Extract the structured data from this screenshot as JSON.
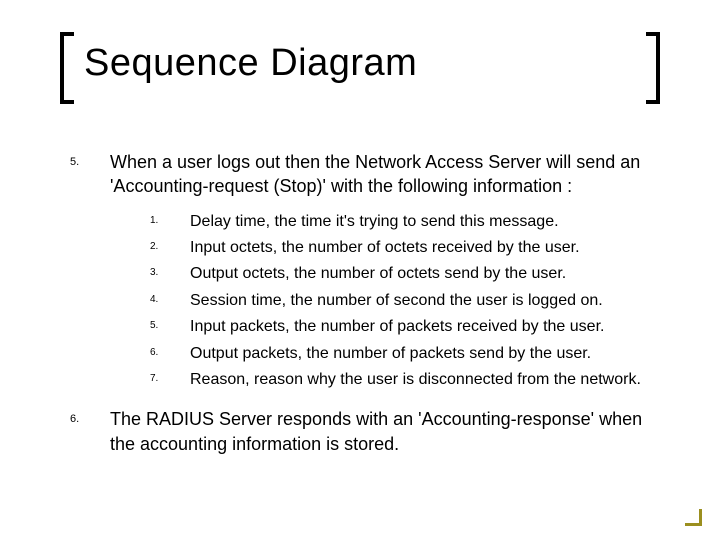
{
  "title": "Sequence Diagram",
  "item5": {
    "num": "5.",
    "text": "When a user logs out then the Network Access Server will send an 'Accounting-request (Stop)' with the following information :",
    "sub": [
      {
        "num": "1.",
        "text": "Delay time, the time it's trying to send this message."
      },
      {
        "num": "2.",
        "text": "Input octets, the number of octets received by the user."
      },
      {
        "num": "3.",
        "text": "Output octets, the number of octets send by the user."
      },
      {
        "num": "4.",
        "text": "Session time, the number of second the user is logged on."
      },
      {
        "num": "5.",
        "text": "Input packets, the number of packets received by the user."
      },
      {
        "num": "6.",
        "text": "Output packets, the number of packets send by the user."
      },
      {
        "num": "7.",
        "text": "Reason, reason why the user is disconnected from the network."
      }
    ]
  },
  "item6": {
    "num": "6.",
    "text": "The RADIUS Server responds with an 'Accounting-response' when the accounting information is stored."
  }
}
